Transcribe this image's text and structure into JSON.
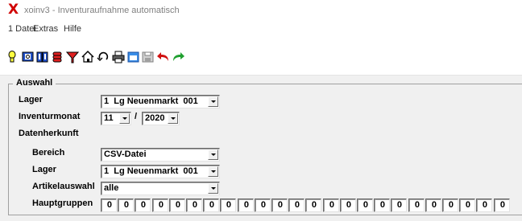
{
  "window": {
    "title": "xoinv3 - Inventuraufnahme automatisch",
    "logo": "X"
  },
  "menu": [
    "1 Datei",
    "Extras",
    "Hilfe"
  ],
  "toolbar": [
    {
      "icon": "lightbulb-icon"
    },
    {
      "icon": "search-card-icon"
    },
    {
      "icon": "book-icon"
    },
    {
      "icon": "database-icon"
    },
    {
      "icon": "funnel-icon"
    },
    {
      "icon": "home-icon"
    },
    {
      "icon": "refresh-icon"
    },
    {
      "icon": "printer-icon"
    },
    {
      "icon": "window-icon"
    },
    {
      "icon": "save-icon"
    },
    {
      "icon": "undo-icon"
    },
    {
      "icon": "redo-icon"
    }
  ],
  "group": {
    "title": "Auswahl"
  },
  "form": {
    "lager_label": "Lager",
    "lager_value": "1  Lg Neuenmarkt  001",
    "inventurmonat_label": "Inventurmonat",
    "month_value": "11",
    "year_separator": "/",
    "year_value": "2020",
    "datenherkunft_label": "Datenherkunft",
    "bereich_label": "Bereich",
    "bereich_value": "CSV-Datei",
    "lager2_label": "Lager",
    "lager2_value": "1  Lg Neuenmarkt  001",
    "artikelauswahl_label": "Artikelauswahl",
    "artikelauswahl_value": "alle",
    "hauptgruppen_label": "Hauptgruppen",
    "hauptgruppen": [
      "0",
      "0",
      "0",
      "0",
      "0",
      "0",
      "0",
      "0",
      "0",
      "0",
      "0",
      "0",
      "0",
      "0",
      "0",
      "0",
      "0",
      "0",
      "0",
      "0",
      "0",
      "0",
      "0",
      "0",
      "0"
    ]
  }
}
